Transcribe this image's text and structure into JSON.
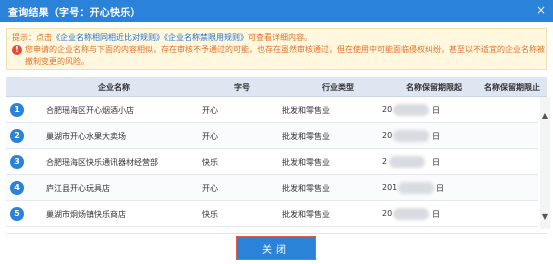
{
  "dialog": {
    "title": "查询结果（字号：开心快乐）",
    "close_icon": "close-icon",
    "close_glyph": "×"
  },
  "notice": {
    "prefix": "提示：点击",
    "link1": "《企业名称相同相近比对规则》",
    "link2": "《企业名称禁限用规则》",
    "suffix": "可查看详细内容。",
    "warn_glyph": "!",
    "warning": "您申请的企业名称与下面的内容相似，存在审核不予通过的可能，也存在虽然审核通过，但在使用中可能面临侵权纠纷，甚至以不适宜的企业名称被撤制变更的风险。",
    "colors": {
      "text": "#e0702a",
      "link": "#1f6fd1",
      "background": "#fff8df"
    }
  },
  "table": {
    "headers": [
      "企业名称",
      "字号",
      "行业类型",
      "名称保留期限起",
      "名称保留期限止"
    ],
    "rows": [
      {
        "num": "1",
        "name": "合肥瑶海区开心烟酒小店",
        "zihao": "开心",
        "industry": "批发和零售业",
        "date_start": "20",
        "date_end": "日"
      },
      {
        "num": "2",
        "name": "巢湖市开心水果大卖场",
        "zihao": "开心",
        "industry": "批发和零售业",
        "date_start": "20",
        "date_end": "日"
      },
      {
        "num": "3",
        "name": "合肥瑶海区快乐通讯器材经营部",
        "zihao": "快乐",
        "industry": "批发和零售业",
        "date_start": "2",
        "date_end": "日"
      },
      {
        "num": "4",
        "name": "庐江县开心玩具店",
        "zihao": "开心",
        "industry": "批发和零售业",
        "date_start": "201",
        "date_end": "日"
      },
      {
        "num": "5",
        "name": "巢湖市烔炀镇快乐商店",
        "zihao": "快乐",
        "industry": "批发和零售业",
        "date_start": "20",
        "date_end": "日"
      }
    ]
  },
  "scroll": {
    "up": "▲",
    "down": "▼"
  },
  "footer": {
    "close_label": "关闭"
  },
  "colors": {
    "accent": "#2b82d9",
    "header_bg": "#dde6f1"
  }
}
